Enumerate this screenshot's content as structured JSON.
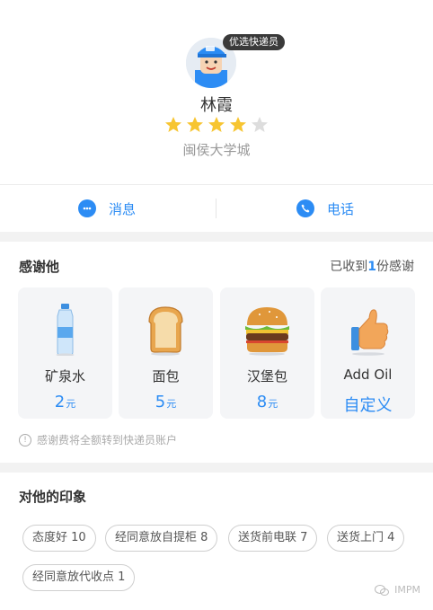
{
  "profile": {
    "badge": "优选快递员",
    "name": "林霞",
    "rating": 4,
    "rating_max": 5,
    "school": "闽侯大学城"
  },
  "actions": {
    "message": "消息",
    "phone": "电话"
  },
  "thanks": {
    "title": "感谢他",
    "received_prefix": "已收到",
    "received_count": "1",
    "received_suffix": "份感谢",
    "gifts": [
      {
        "name": "矿泉水",
        "price": "2",
        "unit": "元"
      },
      {
        "name": "面包",
        "price": "5",
        "unit": "元"
      },
      {
        "name": "汉堡包",
        "price": "8",
        "unit": "元"
      },
      {
        "name": "Add Oil",
        "custom": "自定义"
      }
    ],
    "note": "感谢费将全额转到快递员账户"
  },
  "impressions": {
    "title": "对他的印象",
    "tags": [
      {
        "label": "态度好 10"
      },
      {
        "label": "经同意放自提柜 8"
      },
      {
        "label": "送货前电联 7"
      },
      {
        "label": "送货上门 4"
      },
      {
        "label": "经同意放代收点 1"
      }
    ]
  },
  "watermark": "IMPM",
  "colors": {
    "accent": "#2c8cf4",
    "star": "#f7c531",
    "star_empty": "#dddddd"
  }
}
